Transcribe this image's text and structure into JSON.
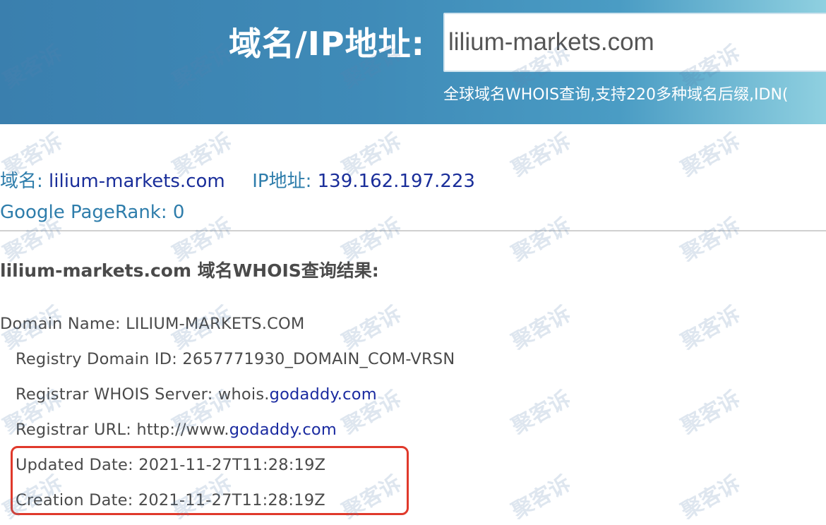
{
  "header": {
    "label": "域名/IP地址:",
    "search_value": "lilium-markets.com",
    "subtitle": "全球域名WHOIS查询,支持220多种域名后缀,IDN("
  },
  "summary": {
    "domain_label": "域名:",
    "domain_value": "lilium-markets.com",
    "ip_label": "IP地址:",
    "ip_value": "139.162.197.223",
    "pagerank_label": "Google PageRank:",
    "pagerank_value": "0"
  },
  "whois": {
    "title": "lilium-markets.com 域名WHOIS查询结果:",
    "domain_name": "Domain Name: LILIUM-MARKETS.COM",
    "registry_domain_id": "Registry Domain ID: 2657771930_DOMAIN_COM-VRSN",
    "whois_server_label": "Registrar WHOIS Server: whois.",
    "whois_server_link": "godaddy.com",
    "registrar_url_label": "Registrar URL: http://www.",
    "registrar_url_link": "godaddy.com",
    "updated_date": "Updated Date: 2021-11-27T11:28:19Z",
    "creation_date": "Creation Date: 2021-11-27T11:28:19Z"
  },
  "watermark": {
    "text": "聚客诉"
  },
  "colors": {
    "header_start": "#3a7fae",
    "header_end": "#8fd0e0",
    "label_blue": "#2e7dab",
    "value_navy": "#1a2e9a",
    "highlight_red": "#e0392b"
  }
}
